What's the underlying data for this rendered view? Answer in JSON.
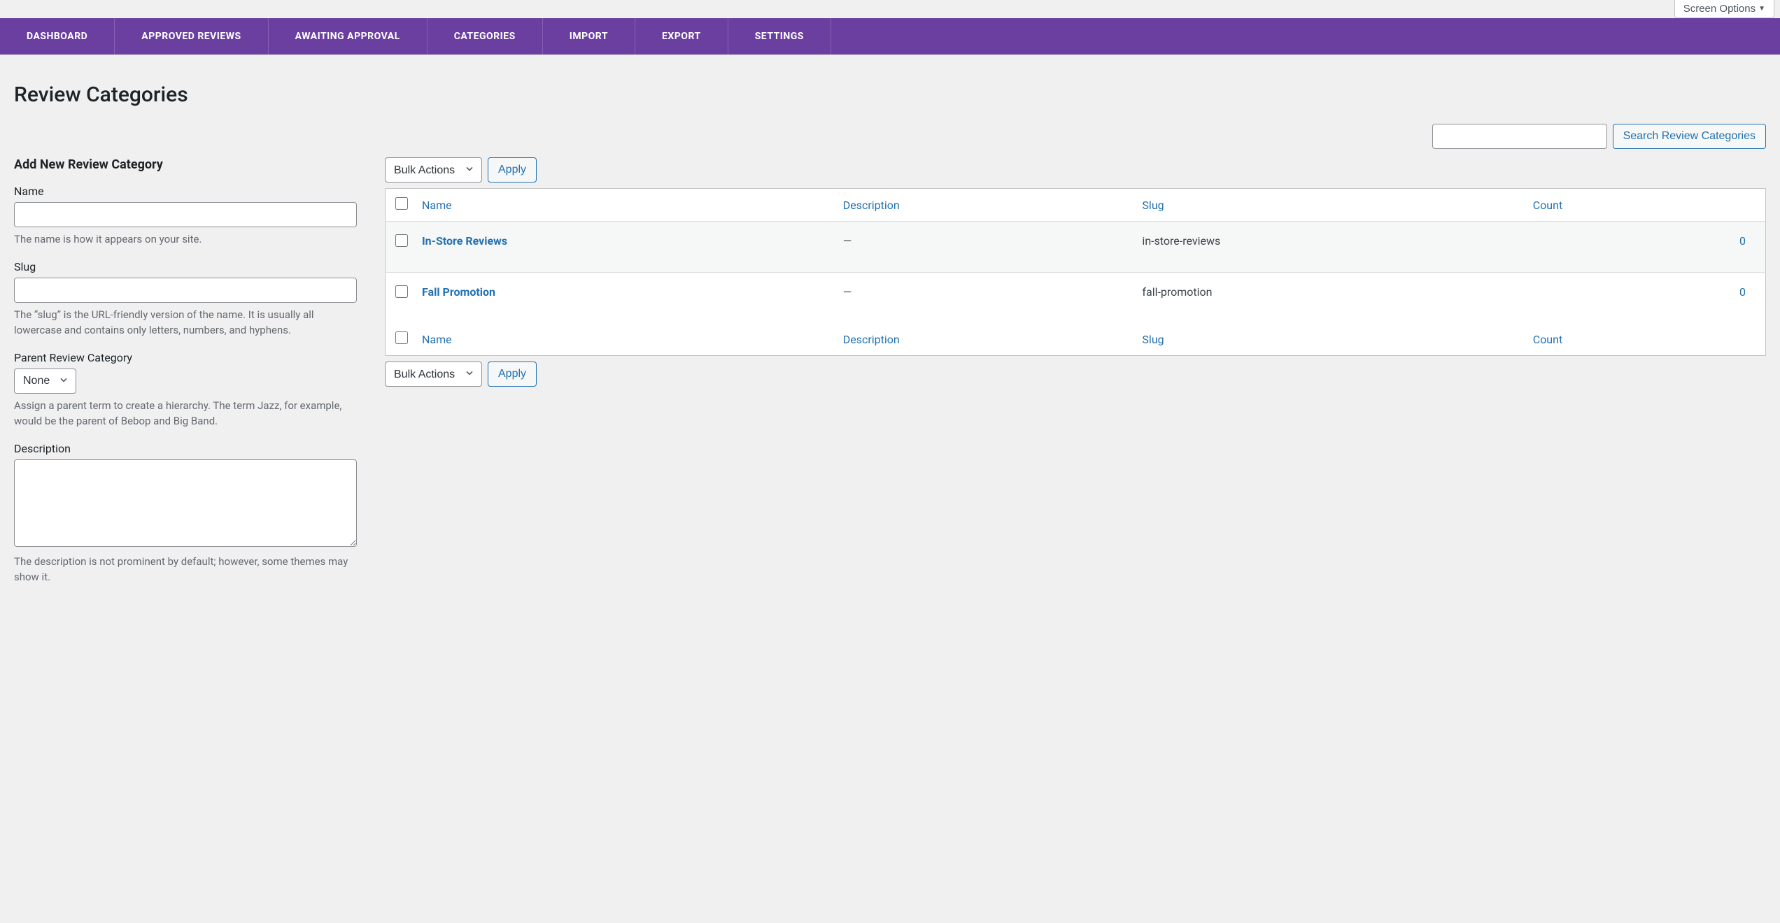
{
  "screen_options_label": "Screen Options",
  "nav": {
    "tabs": [
      {
        "label": "DASHBOARD"
      },
      {
        "label": "APPROVED REVIEWS"
      },
      {
        "label": "AWAITING APPROVAL"
      },
      {
        "label": "CATEGORIES"
      },
      {
        "label": "IMPORT"
      },
      {
        "label": "EXPORT"
      },
      {
        "label": "SETTINGS"
      }
    ]
  },
  "page_title": "Review Categories",
  "search": {
    "button_label": "Search Review Categories"
  },
  "form": {
    "heading": "Add New Review Category",
    "name": {
      "label": "Name",
      "help": "The name is how it appears on your site."
    },
    "slug": {
      "label": "Slug",
      "help": "The “slug” is the URL-friendly version of the name. It is usually all lowercase and contains only letters, numbers, and hyphens."
    },
    "parent": {
      "label": "Parent Review Category",
      "selected": "None",
      "options": [
        "None"
      ],
      "help": "Assign a parent term to create a hierarchy. The term Jazz, for example, would be the parent of Bebop and Big Band."
    },
    "description": {
      "label": "Description",
      "help": "The description is not prominent by default; however, some themes may show it."
    }
  },
  "bulk": {
    "selected": "Bulk Actions",
    "options": [
      "Bulk Actions"
    ],
    "apply_label": "Apply"
  },
  "table": {
    "headers": {
      "name": "Name",
      "description": "Description",
      "slug": "Slug",
      "count": "Count"
    },
    "rows": [
      {
        "name": "In-Store Reviews",
        "description": "—",
        "slug": "in-store-reviews",
        "count": "0"
      },
      {
        "name": "Fall Promotion",
        "description": "—",
        "slug": "fall-promotion",
        "count": "0"
      }
    ]
  }
}
